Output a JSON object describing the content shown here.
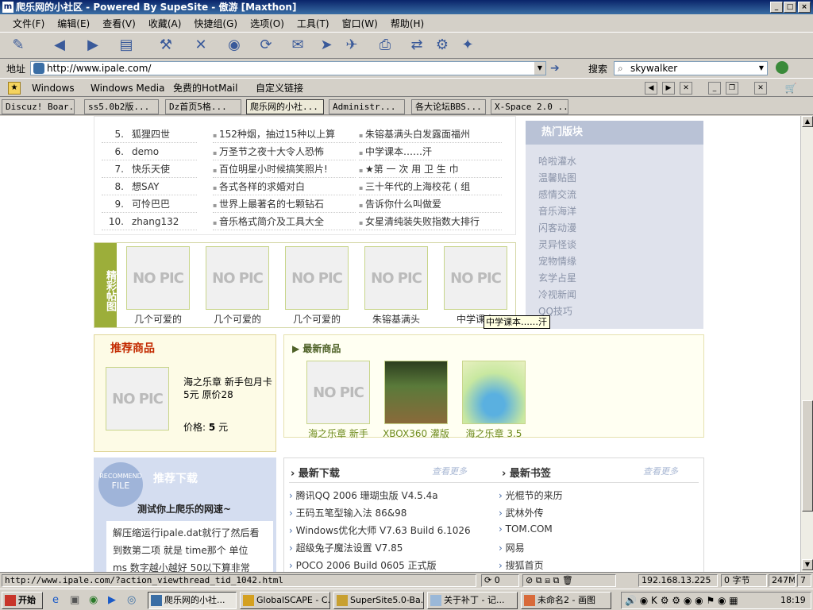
{
  "window": {
    "title": "爬乐网的小社区 - Powered By SupeSite - 傲游 [Maxthon]"
  },
  "menu": [
    "文件(F)",
    "编辑(E)",
    "查看(V)",
    "收藏(A)",
    "快捷组(G)",
    "选项(O)",
    "工具(T)",
    "窗口(W)",
    "帮助(H)"
  ],
  "address": {
    "label": "地址",
    "url": "http://www.ipale.com/",
    "search_label": "搜索",
    "search_value": "skywalker"
  },
  "links": [
    "Windows",
    "Windows Media",
    "免费的HotMail",
    "自定义链接"
  ],
  "tabs": [
    "Discuz! Boar...",
    "ss5.0b2版...",
    "Dz首页5格...",
    "爬乐网的小社...",
    "Administr...",
    "各大论坛BBS...",
    "X-Space 2.0 ..."
  ],
  "ranking": {
    "rows": [
      {
        "num": "5.",
        "name": "狐狸四世"
      },
      {
        "num": "6.",
        "name": "demo"
      },
      {
        "num": "7.",
        "name": "快乐天使"
      },
      {
        "num": "8.",
        "name": "想SAY"
      },
      {
        "num": "9.",
        "name": "可怜巴巴"
      },
      {
        "num": "10.",
        "name": "zhang132"
      }
    ]
  },
  "threads_left": [
    "152种烟，抽过15种以上算",
    "万圣节之夜十大令人恐怖",
    "百位明星小时候搞笑照片!",
    "各式各样的求婚对白",
    "世界上最著名的七颗钻石",
    "音乐格式简介及工具大全"
  ],
  "threads_right": [
    "朱镕基满头白发露面福州",
    "中学课本……汗",
    "★第 一 次 用 卫 生 巾",
    "三十年代的上海校花 ( 组",
    "告诉你什么叫做爱",
    "女星清纯装失败指数大排行"
  ],
  "hot_boards": {
    "title": "热门版块",
    "items": [
      "哈啦灌水",
      "温馨贴图",
      "感情交流",
      "音乐海洋",
      "闪客动漫",
      "灵异怪谈",
      "宠物情缘",
      "玄学占星",
      "冷视新闻",
      "QQ技巧"
    ]
  },
  "featured_pics": {
    "label": "精彩帖图",
    "nopic_text": "NO PIC",
    "captions": [
      "几个可爱的",
      "几个可爱的",
      "几个可爱的",
      "朱镕基满头",
      "中学课本"
    ]
  },
  "tooltip": "中学课本……汗",
  "recommended_goods": {
    "title": "推荐商品",
    "name": "海之乐章 新手包月卡",
    "price_text": "5元 原价28",
    "price_label": "价格:",
    "price": "5",
    "unit": "元"
  },
  "new_goods": {
    "title": "最新商品",
    "items": [
      "海之乐章 新手",
      "XBOX360 灌版",
      "海之乐章 3.5"
    ]
  },
  "recommended_download": {
    "badge_top": "RECOMMEND",
    "badge_bottom": "FILE",
    "title": "推荐下载",
    "subtitle": "测试你上爬乐的网速~",
    "text1": "解压缩运行ipale.dat就行了然后看",
    "text2": "到数第二项 就是 time那个 单位",
    "text3": "ms 数字越小越好 50以下算非常"
  },
  "latest_downloads": {
    "title": "最新下载",
    "more": "查看更多",
    "items": [
      "腾讯QQ 2006 珊瑚虫版 V4.5.4a",
      "王码五笔型输入法 86&98",
      "Windows优化大师 V7.63 Build 6.1026",
      "超级兔子魔法设置 V7.85",
      "POCO 2006 Build 0605 正式版"
    ]
  },
  "latest_bookmarks": {
    "title": "最新书签",
    "more": "查看更多",
    "items": [
      "光棍节的来历",
      "武林外传",
      "TOM.COM",
      "网易",
      "搜狐首页"
    ]
  },
  "status": {
    "url": "http://www.ipale.com/?action_viewthread_tid_1042.html",
    "count": "0",
    "ip": "192.168.13.225",
    "bytes": "0 字节",
    "mem": "247M",
    "num": "7"
  },
  "taskbar": {
    "start": "开始",
    "items": [
      "爬乐网的小社...",
      "GlobalSCAPE - C...",
      "SuperSite5.0-Ba...",
      "关于补丁 - 记...",
      "未命名2 - 画图"
    ],
    "clock": "18:19"
  }
}
